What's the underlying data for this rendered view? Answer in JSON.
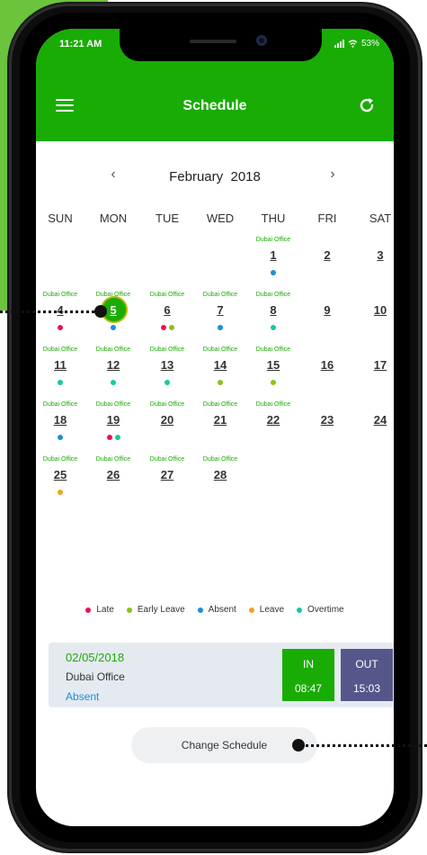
{
  "status_bar": {
    "time": "11:21 AM",
    "battery": "53%"
  },
  "appbar": {
    "title": "Schedule",
    "menu_icon": "menu-icon",
    "refresh_icon": "refresh-icon"
  },
  "calendar": {
    "month": "February",
    "year": "2018",
    "prev_label": "‹",
    "next_label": "›",
    "weekdays": [
      "SUN",
      "MON",
      "TUE",
      "WED",
      "THU",
      "FRI",
      "SAT"
    ],
    "selected_day": "5",
    "days": [
      {
        "day": "1",
        "office": "Dubai Office",
        "dots": [
          "absent"
        ]
      },
      {
        "day": "2",
        "office": "",
        "dots": []
      },
      {
        "day": "3",
        "office": "",
        "dots": []
      },
      {
        "day": "4",
        "office": "Dubai Office",
        "dots": [
          "late"
        ]
      },
      {
        "day": "5",
        "office": "Dubai Office",
        "dots": [
          "absent"
        ]
      },
      {
        "day": "6",
        "office": "Dubai Office",
        "dots": [
          "late",
          "early_leave"
        ]
      },
      {
        "day": "7",
        "office": "Dubai Office",
        "dots": [
          "absent"
        ]
      },
      {
        "day": "8",
        "office": "Dubai Office",
        "dots": [
          "overtime"
        ]
      },
      {
        "day": "9",
        "office": "",
        "dots": []
      },
      {
        "day": "10",
        "office": "",
        "dots": []
      },
      {
        "day": "11",
        "office": "Dubai Office",
        "dots": [
          "overtime"
        ]
      },
      {
        "day": "12",
        "office": "Dubai Office",
        "dots": [
          "overtime"
        ]
      },
      {
        "day": "13",
        "office": "Dubai Office",
        "dots": [
          "overtime"
        ]
      },
      {
        "day": "14",
        "office": "Dubai Office",
        "dots": [
          "early_leave"
        ]
      },
      {
        "day": "15",
        "office": "Dubai Office",
        "dots": [
          "early_leave"
        ]
      },
      {
        "day": "16",
        "office": "",
        "dots": []
      },
      {
        "day": "17",
        "office": "",
        "dots": []
      },
      {
        "day": "18",
        "office": "Dubai Office",
        "dots": [
          "absent"
        ]
      },
      {
        "day": "19",
        "office": "Dubai Office",
        "dots": [
          "late",
          "overtime"
        ]
      },
      {
        "day": "20",
        "office": "Dubai Office",
        "dots": []
      },
      {
        "day": "21",
        "office": "Dubai Office",
        "dots": []
      },
      {
        "day": "22",
        "office": "Dubai Office",
        "dots": []
      },
      {
        "day": "23",
        "office": "",
        "dots": []
      },
      {
        "day": "24",
        "office": "",
        "dots": []
      },
      {
        "day": "25",
        "office": "Dubai Office",
        "dots": [
          "leave"
        ]
      },
      {
        "day": "26",
        "office": "Dubai Office",
        "dots": []
      },
      {
        "day": "27",
        "office": "Dubai Office",
        "dots": []
      },
      {
        "day": "28",
        "office": "Dubai Office",
        "dots": []
      }
    ]
  },
  "legend": [
    {
      "key": "late",
      "label": "Late",
      "color": "#e8125c"
    },
    {
      "key": "early_leave",
      "label": "Early Leave",
      "color": "#8cc21a"
    },
    {
      "key": "absent",
      "label": "Absent",
      "color": "#1a8fdc"
    },
    {
      "key": "leave",
      "label": "Leave",
      "color": "#f2a31b"
    },
    {
      "key": "overtime",
      "label": "Overtime",
      "color": "#18c9a0"
    }
  ],
  "summary": {
    "date": "02/05/2018",
    "office": "Dubai Office",
    "status": "Absent",
    "in_label": "IN",
    "in_time": "08:47",
    "out_label": "OUT",
    "out_time": "15:03"
  },
  "change_schedule_label": "Change Schedule",
  "colors": {
    "brand": "#19ac05",
    "out_tile": "#55578a",
    "status_absent": "#1a8fdc"
  }
}
